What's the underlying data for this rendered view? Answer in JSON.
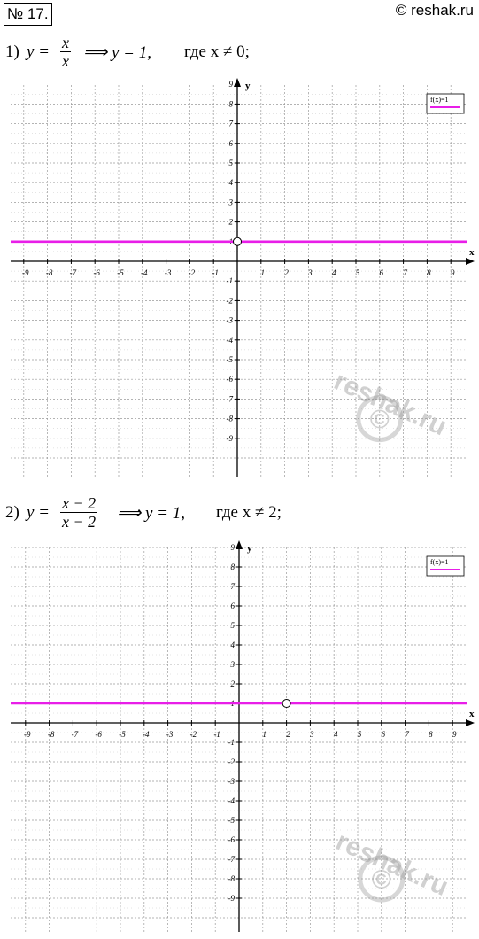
{
  "header": {
    "problem_number": "№ 17.",
    "site": "© reshak.ru"
  },
  "graphs": [
    {
      "id": "g1",
      "label": "1)",
      "fraction": {
        "numerator": "x",
        "denominator": "x"
      },
      "result": "⟹ y = 1,",
      "condition": "где x ≠ 0;",
      "legend": "f(x)=1",
      "x_axis_label": "x",
      "y_axis_label": "y",
      "function_color": "#e81ee8",
      "hole": {
        "x": 0,
        "y": 1
      },
      "watermark": true
    },
    {
      "id": "g2",
      "label": "2)",
      "fraction": {
        "numerator": "x − 2",
        "denominator": "x − 2"
      },
      "result": "⟹ y = 1,",
      "condition": "где x ≠ 2;",
      "legend": "f(x)=1",
      "x_axis_label": "x",
      "y_axis_label": "y",
      "function_color": "#e81ee8",
      "hole": {
        "x": 2,
        "y": 1
      },
      "watermark": true
    }
  ],
  "chart_data": [
    {
      "type": "line",
      "series": [
        {
          "name": "f(x)=1",
          "x": [
            -10,
            10
          ],
          "y": [
            1,
            1
          ],
          "excluded_point": [
            0,
            1
          ]
        }
      ],
      "xlim": [
        -10,
        10
      ],
      "ylim": [
        -10,
        10
      ],
      "xticks": [
        -9,
        -8,
        -7,
        -6,
        -5,
        -4,
        -3,
        -2,
        -1,
        1,
        2,
        3,
        4,
        5,
        6,
        7,
        8,
        9
      ],
      "yticks": [
        -9,
        -8,
        -7,
        -6,
        -5,
        -4,
        -3,
        -2,
        -1,
        1,
        2,
        3,
        4,
        5,
        6,
        7,
        8,
        9
      ],
      "grid": true,
      "legend_position": "top-right",
      "xlabel": "x",
      "ylabel": "y"
    },
    {
      "type": "line",
      "series": [
        {
          "name": "f(x)=1",
          "x": [
            -10,
            10
          ],
          "y": [
            1,
            1
          ],
          "excluded_point": [
            2,
            1
          ]
        }
      ],
      "xlim": [
        -10,
        10
      ],
      "ylim": [
        -10,
        10
      ],
      "xticks": [
        -9,
        -8,
        -7,
        -6,
        -5,
        -4,
        -3,
        -2,
        -1,
        1,
        2,
        3,
        4,
        5,
        6,
        7,
        8,
        9
      ],
      "yticks": [
        -9,
        -8,
        -7,
        -6,
        -5,
        -4,
        -3,
        -2,
        -1,
        1,
        2,
        3,
        4,
        5,
        6,
        7,
        8,
        9
      ],
      "grid": true,
      "legend_position": "top-right",
      "xlabel": "x",
      "ylabel": "y"
    }
  ],
  "watermark": {
    "text": "reshak.ru",
    "symbol": "©"
  }
}
